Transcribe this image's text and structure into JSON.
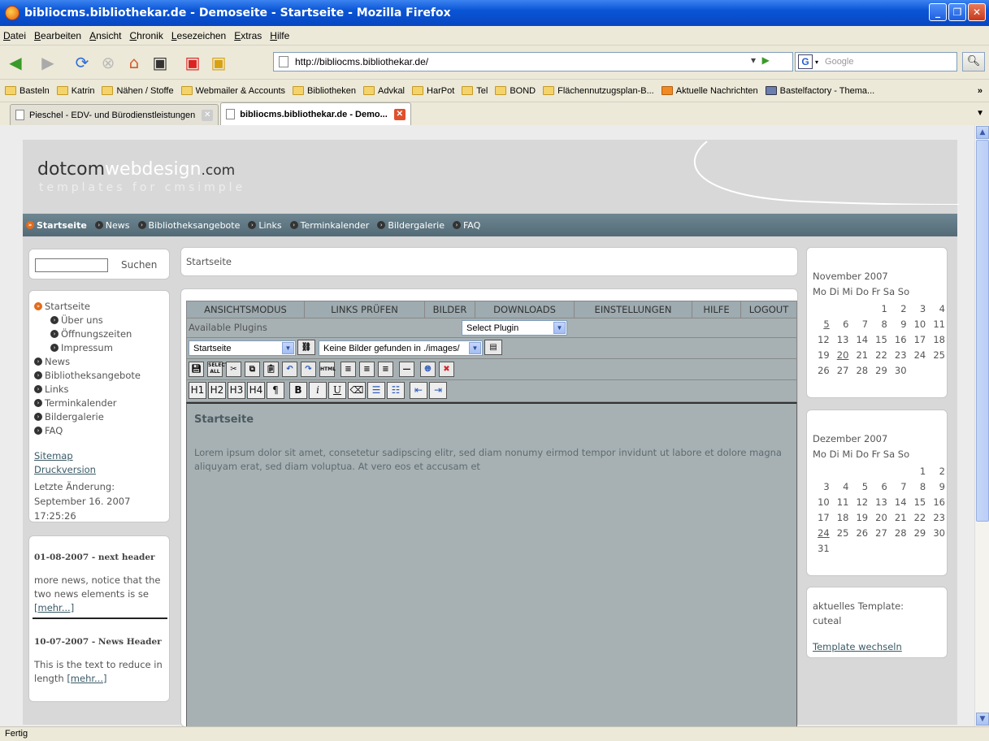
{
  "window": {
    "title": "bibliocms.bibliothekar.de - Demoseite - Startseite - Mozilla Firefox"
  },
  "menu": [
    "Datei",
    "Bearbeiten",
    "Ansicht",
    "Chronik",
    "Lesezeichen",
    "Extras",
    "Hilfe"
  ],
  "nav": {
    "url": "http://bibliocms.bibliothekar.de/",
    "search_placeholder": "Google"
  },
  "bookmarks": [
    "Basteln",
    "Katrin",
    "Nähen / Stoffe",
    "Webmailer & Accounts",
    "Bibliotheken",
    "Advkal",
    "HarPot",
    "Tel",
    "BOND",
    "Flächennutzugsplan-B...",
    "Aktuelle Nachrichten",
    "Bastelfactory - Thema..."
  ],
  "tabs": [
    {
      "label": "Pieschel - EDV- und Bürodienstleistungen"
    },
    {
      "label": "bibliocms.bibliothekar.de - Demo..."
    }
  ],
  "status": "Fertig",
  "site": {
    "logo_a": "dotcom",
    "logo_b": "webdesign",
    "logo_c": ".com",
    "tagline": "templates for cmsimple",
    "topnav": [
      "Startseite",
      "News",
      "Bibliotheksangebote",
      "Links",
      "Terminkalender",
      "Bildergalerie",
      "FAQ"
    ],
    "search_label": "Suchen",
    "leftnav": [
      "Startseite",
      "Über uns",
      "Öffnungszeiten",
      "Impressum",
      "News",
      "Bibliotheksangebote",
      "Links",
      "Terminkalender",
      "Bildergalerie",
      "FAQ"
    ],
    "sitemap": "Sitemap",
    "print": "Druckversion",
    "last_change_label": "Letzte Änderung:",
    "last_change_date": "September 16. 2007",
    "last_change_time": "17:25:26",
    "news": [
      {
        "header": "01-08-2007 - next header",
        "text": "more news, notice that the two news elements is se",
        "more": "[mehr...]"
      },
      {
        "header": "10-07-2007 - News Header",
        "text": "This is the text to reduce in length",
        "more": "[mehr...]"
      }
    ],
    "breadcrumb": "Startseite",
    "editor_tabs": [
      "ANSICHTSMODUS",
      "LINKS PRÜFEN",
      "BILDER",
      "DOWNLOADS",
      "EINSTELLUNGEN",
      "HILFE",
      "LOGOUT"
    ],
    "plugins_label": "Available Plugins",
    "plugin_select": "Select Plugin",
    "page_select": "Startseite",
    "image_select": "Keine Bilder gefunden in ./images/",
    "heading_buttons": [
      "H1",
      "H2",
      "H3",
      "H4",
      "¶"
    ],
    "content_heading": "Startseite",
    "content_text": "Lorem ipsum dolor sit amet, consetetur sadipscing elitr, sed diam nonumy eirmod tempor invidunt ut labore et dolore magna aliquyam erat, sed diam voluptua. At vero eos et accusam et",
    "cal1_title": "November 2007",
    "cal2_title": "Dezember 2007",
    "weekdays": "Mo Di Mi Do Fr Sa So",
    "template_label": "aktuelles Template:",
    "template_name": "cuteal",
    "template_switch": "Template wechseln"
  },
  "calendars": [
    {
      "weeks": [
        [
          "",
          "",
          "",
          "1",
          "2",
          "3",
          "4"
        ],
        [
          "5",
          "6",
          "7",
          "8",
          "9",
          "10",
          "11"
        ],
        [
          "12",
          "13",
          "14",
          "15",
          "16",
          "17",
          "18"
        ],
        [
          "19",
          "20",
          "21",
          "22",
          "23",
          "24",
          "25"
        ],
        [
          "26",
          "27",
          "28",
          "29",
          "30",
          "",
          ""
        ]
      ],
      "links": [
        "5",
        "20"
      ]
    },
    {
      "weeks": [
        [
          "",
          "",
          "",
          "",
          "",
          "1",
          "2"
        ],
        [
          "3",
          "4",
          "5",
          "6",
          "7",
          "8",
          "9"
        ],
        [
          "10",
          "11",
          "12",
          "13",
          "14",
          "15",
          "16"
        ],
        [
          "17",
          "18",
          "19",
          "20",
          "21",
          "22",
          "23"
        ],
        [
          "24",
          "25",
          "26",
          "27",
          "28",
          "29",
          "30"
        ],
        [
          "31",
          "",
          "",
          "",
          "",
          "",
          ""
        ]
      ],
      "links": [
        "24"
      ]
    }
  ]
}
